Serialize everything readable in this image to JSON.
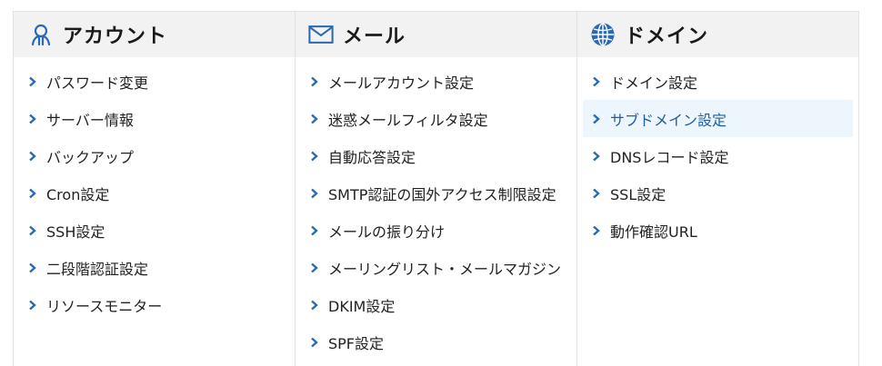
{
  "colors": {
    "accent": "#2a6ab3",
    "active_bg": "#eef6fd",
    "header_bg": "#f2f2f2"
  },
  "columns": [
    {
      "icon": "user-icon",
      "title": "アカウント",
      "items": [
        "パスワード変更",
        "サーバー情報",
        "バックアップ",
        "Cron設定",
        "SSH設定",
        "二段階認証設定",
        "リソースモニター"
      ]
    },
    {
      "icon": "mail-icon",
      "title": "メール",
      "items": [
        "メールアカウント設定",
        "迷惑メールフィルタ設定",
        "自動応答設定",
        "SMTP認証の国外アクセス制限設定",
        "メールの振り分け",
        "メーリングリスト・メールマガジン",
        "DKIM設定",
        "SPF設定"
      ]
    },
    {
      "icon": "globe-icon",
      "title": "ドメイン",
      "items": [
        "ドメイン設定",
        "サブドメイン設定",
        "DNSレコード設定",
        "SSL設定",
        "動作確認URL"
      ],
      "active_item": "サブドメイン設定"
    }
  ]
}
